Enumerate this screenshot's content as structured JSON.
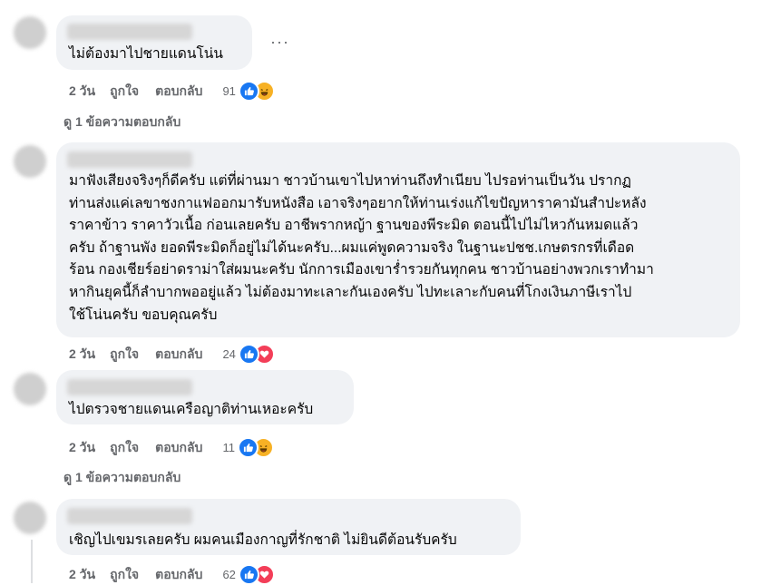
{
  "comments": [
    {
      "text": "ไม่ต้องมาไปชายแดนโน่น",
      "time": "2 วัน",
      "like": "ถูกใจ",
      "reply": "ตอบกลับ",
      "reaction_count": "91",
      "reactions": [
        "like-icon",
        "haha-icon"
      ],
      "replies_label": "ดู 1 ข้อความตอบกลับ",
      "more": "···"
    },
    {
      "text": "มาฟังเสียงจริงๆก็ดีครับ แต่ที่ผ่านมา ชาวบ้านเขาไปหาท่านถึงทำเนียบ ไปรอท่านเป็นวัน ปรากฏ\nท่านส่งแค่เลขาชงกาแฟออกมารับหนังสือ เอาจริงๆอยากให้ท่านเร่งแก้ไขปัญหาราคามันสำปะหลัง\nราคาข้าว ราคาวัวเนื้อ ก่อนเลยครับ อาชีพรากหญ้า ฐานของพีระมิด ตอนนี้ไปไม่ไหวกันหมดแล้ว\nครับ ถ้าฐานพัง ยอดพีระมิดก็อยู่ไม่ได้นะครับ...ผมแค่พูดความจริง ในฐานะปชช.เกษตรกรที่เดือด\nร้อน กองเชียร์อย่าดราม่าใส่ผมนะครับ นักการเมืองเขาร่ำรวยกันทุกคน ชาวบ้านอย่างพวกเราทำมา\nหากินยุคนี้ก็ลำบากพออยู่แล้ว ไม่ต้องมาทะเลาะกันเองครับ ไปทะเลาะกับคนที่โกงเงินภาษีเราไป\nใช้โน่นครับ ขอบคุณครับ",
      "time": "2 วัน",
      "like": "ถูกใจ",
      "reply": "ตอบกลับ",
      "reaction_count": "24",
      "reactions": [
        "like-icon",
        "love-icon"
      ]
    },
    {
      "text": "ไปตรวจชายแดนเครือญาติท่านเหอะครับ",
      "time": "2 วัน",
      "like": "ถูกใจ",
      "reply": "ตอบกลับ",
      "reaction_count": "11",
      "reactions": [
        "like-icon",
        "haha-icon"
      ],
      "replies_label": "ดู 1 ข้อความตอบกลับ"
    },
    {
      "text": "เชิญไปเขมรเลยครับ ผมคนเมืองกาญที่รักชาติ ไม่ยินดีต้อนรับครับ",
      "time": "2 วัน",
      "like": "ถูกใจ",
      "reply": "ตอบกลับ",
      "reaction_count": "62",
      "reactions": [
        "like-icon",
        "love-icon"
      ]
    }
  ],
  "colors": {
    "bubble": "#f0f2f5",
    "meta": "#65676b",
    "like": "#1877f2",
    "love": "#f33e58",
    "haha": "#f7b125"
  }
}
